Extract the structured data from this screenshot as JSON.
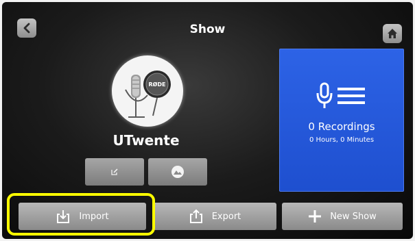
{
  "header": {
    "title": "Show",
    "back_icon": "chevron-left-icon",
    "home_icon": "home-icon"
  },
  "show": {
    "name": "UTwente",
    "avatar_logo_text": "RØDE",
    "edit_icon": "edit-icon",
    "image_icon": "image-icon"
  },
  "recordings": {
    "icon": "microphone-list-icon",
    "count_label": "0 Recordings",
    "duration_label": "0 Hours, 0 Minutes"
  },
  "actions": {
    "import_label": "Import",
    "export_label": "Export",
    "new_show_label": "New Show"
  },
  "colors": {
    "panel_blue": "#2459e0",
    "highlight": "#ffff00",
    "button_gray": "#9a9a9a"
  }
}
